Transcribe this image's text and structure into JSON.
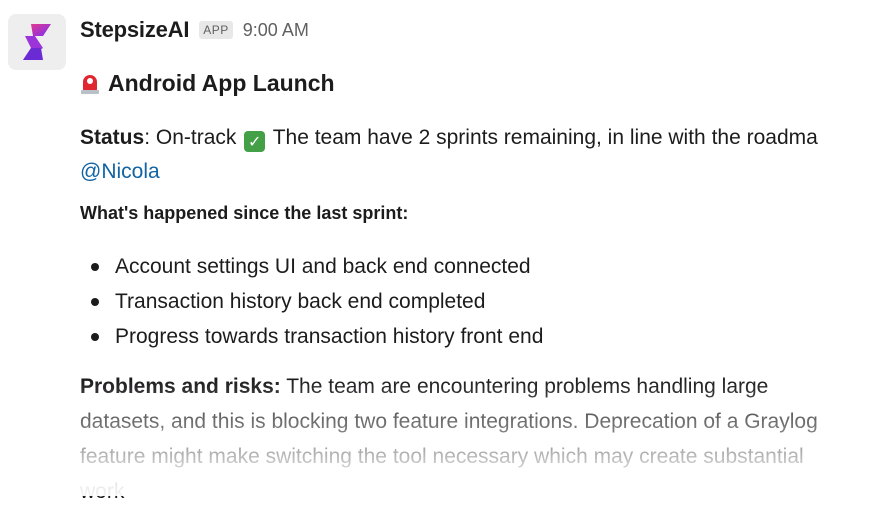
{
  "message": {
    "sender": "StepsizeAI",
    "badge": "APP",
    "timestamp": "9:00 AM",
    "avatar_icon": "stepsize-logo-icon",
    "title_icon": "rotating-light-icon",
    "title": "Android App Launch",
    "status": {
      "label": "Status",
      "value": "On-track",
      "icon": "check-mark-button-icon",
      "text": "The team have 2 sprints remaining, in line with the roadma",
      "mention": "@Nicola"
    },
    "subheading": "What's happened since the last sprint:",
    "bullets": [
      "Account settings UI and back end connected",
      "Transaction history back end completed",
      "Progress towards transaction history front end"
    ],
    "problems": {
      "label": "Problems and risks:",
      "text": "The team are encountering problems handling large datasets, and this is blocking two feature integrations. Deprecation of a Graylog feature might make switching the tool necessary which may create substantial work"
    }
  },
  "colors": {
    "text": "#1d1c1d",
    "muted": "#616061",
    "mention": "#1264a3",
    "brand_purple": "#7b2ff7",
    "brand_pink": "#e23a8c",
    "siren_red": "#e0262f",
    "check_green": "#43a047"
  }
}
